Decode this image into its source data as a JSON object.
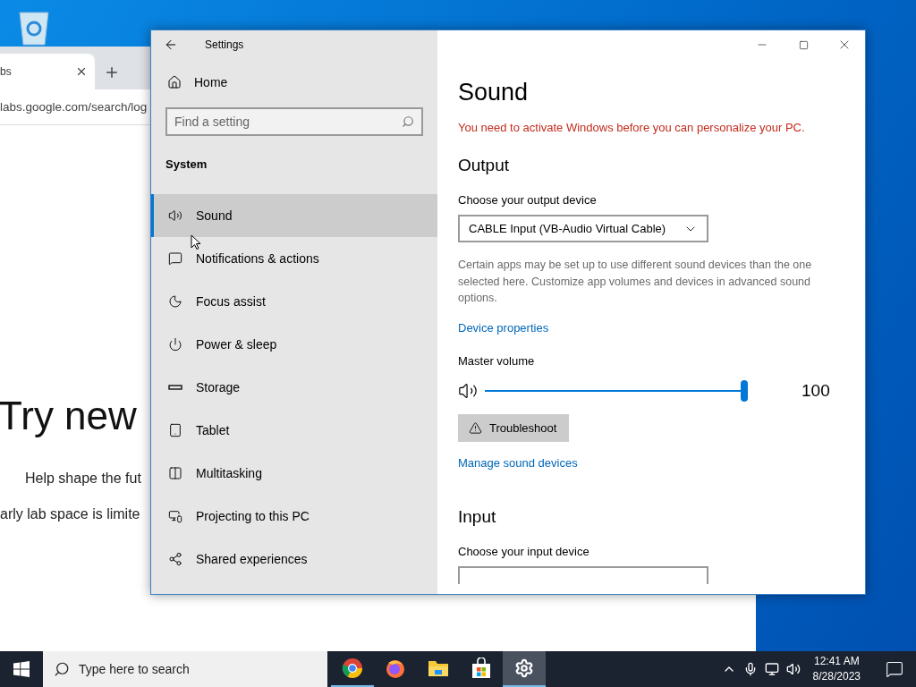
{
  "browser": {
    "tab": {
      "title": "bs"
    },
    "address": "labs.google.com/search/log",
    "heading": "Try new",
    "lines": [
      "Help shape the fut",
      "arly lab space is limite"
    ]
  },
  "settings": {
    "title": "Settings",
    "home": "Home",
    "search": {
      "placeholder": "Find a setting"
    },
    "section": "System",
    "nav": [
      {
        "label": "Sound",
        "selected": true
      },
      {
        "label": "Notifications & actions",
        "selected": false
      },
      {
        "label": "Focus assist",
        "selected": false
      },
      {
        "label": "Power & sleep",
        "selected": false
      },
      {
        "label": "Storage",
        "selected": false
      },
      {
        "label": "Tablet",
        "selected": false
      },
      {
        "label": "Multitasking",
        "selected": false
      },
      {
        "label": "Projecting to this PC",
        "selected": false
      },
      {
        "label": "Shared experiences",
        "selected": false
      }
    ],
    "page": {
      "title": "Sound",
      "warning": "You need to activate Windows before you can personalize your PC.",
      "output": {
        "heading": "Output",
        "device_label": "Choose your output device",
        "device": "CABLE Input (VB-Audio Virtual Cable)",
        "note": "Certain apps may be set up to use different sound devices than the one selected here. Customize app volumes and devices in advanced sound options.",
        "link": "Device properties",
        "volume_label": "Master volume",
        "level": 1,
        "reading": "100",
        "troubleshoot": "Troubleshoot",
        "manage_link": "Manage sound devices"
      },
      "input": {
        "heading": "Input",
        "device_label": "Choose your input device"
      }
    }
  },
  "taskbar": {
    "search": {
      "placeholder": "Type here to search"
    },
    "apps": [
      {
        "running": true,
        "selected": false
      },
      {
        "running": false,
        "selected": false
      },
      {
        "running": false,
        "selected": false
      },
      {
        "running": false,
        "selected": false
      },
      {
        "running": true,
        "selected": true
      }
    ],
    "time": "12:41 AM",
    "date": "8/28/2023"
  }
}
